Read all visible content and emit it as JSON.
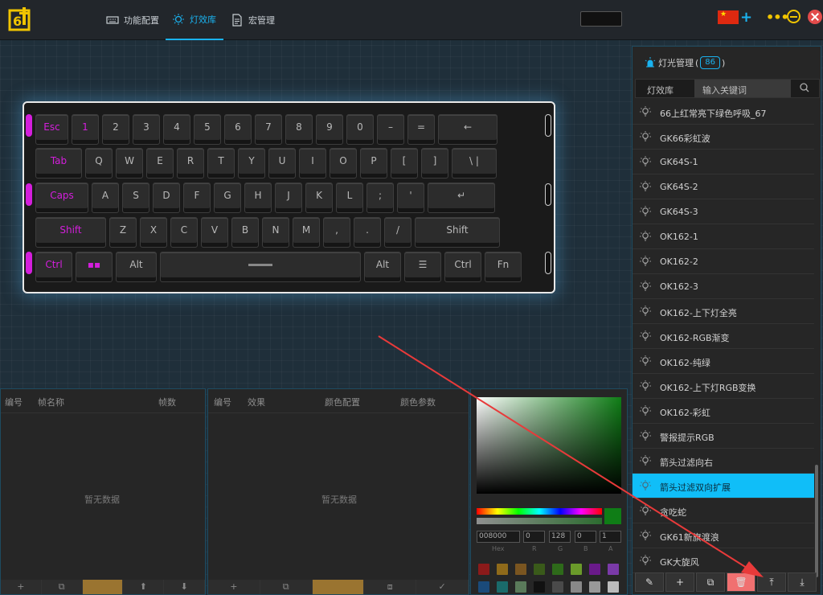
{
  "nav": {
    "tabs": [
      {
        "label": "功能配置",
        "icon": "keyboard-icon"
      },
      {
        "label": "灯效库",
        "icon": "light-icon",
        "active": true
      },
      {
        "label": "宏管理",
        "icon": "document-icon"
      }
    ]
  },
  "window": {
    "more_icon": "•••"
  },
  "keyboard": {
    "accent_color": "#d41edc",
    "rows": [
      [
        "Esc",
        "1",
        "2",
        "3",
        "4",
        "5",
        "6",
        "7",
        "8",
        "9",
        "0",
        "–",
        "=",
        "←"
      ],
      [
        "Tab",
        "Q",
        "W",
        "E",
        "R",
        "T",
        "Y",
        "U",
        "I",
        "O",
        "P",
        "[",
        "]",
        "\\ |"
      ],
      [
        "Caps",
        "A",
        "S",
        "D",
        "F",
        "G",
        "H",
        "J",
        "K",
        "L",
        ";",
        "'",
        "↵"
      ],
      [
        "Shift",
        "Z",
        "X",
        "C",
        "V",
        "B",
        "N",
        "M",
        ",",
        ".",
        "/",
        "Shift"
      ],
      [
        "Ctrl",
        "▪▪",
        "Alt",
        "",
        "Alt",
        "☰",
        "Ctrl",
        "Fn"
      ]
    ],
    "lit_keys": [
      "Esc",
      "1",
      "Tab",
      "Caps",
      "Shift",
      "Ctrl",
      "▪▪"
    ]
  },
  "frames_panel": {
    "headers": [
      "编号",
      "帧名称",
      "帧数"
    ],
    "empty": "暂无数据",
    "toolbar": [
      "+",
      "⧉",
      "",
      "⬆",
      "⬇"
    ]
  },
  "effects_panel": {
    "headers": [
      "编号",
      "效果",
      "颜色配置",
      "颜色参数"
    ],
    "empty": "暂无数据",
    "toolbar": [
      "+",
      "⧉",
      "",
      "⧈",
      "✓"
    ]
  },
  "color_picker": {
    "hex": "008000",
    "r": "0",
    "g": "128",
    "b": "0",
    "a": "1",
    "labels": [
      "Hex",
      "R",
      "G",
      "B",
      "A"
    ],
    "swatches": [
      "#8b1a1a",
      "#8f6a1a",
      "#7a5520",
      "#3a5a1a",
      "#2e6a1a",
      "#6a9a2a",
      "#6a1a8a",
      "#7a3aa8",
      "#1a4a7a",
      "#1a6a6a",
      "#5a7a5a",
      "#111111",
      "#4a4a4a",
      "#888888",
      "#999999",
      "#bbbbbb"
    ]
  },
  "library": {
    "title": "灯光管理",
    "count": "86",
    "tab": "灯效库",
    "search_placeholder": "输入关键词",
    "items": [
      "66上红常亮下绿色呼吸_67",
      "GK66彩虹波",
      "GK64S-1",
      "GK64S-2",
      "GK64S-3",
      "OK162-1",
      "OK162-2",
      "OK162-3",
      "OK162-上下灯全亮",
      "OK162-RGB渐变",
      "OK162-纯绿",
      "OK162-上下灯RGB变换",
      "OK162-彩虹",
      "警报提示RGB",
      "箭头过滤向右",
      "箭头过滤双向扩展",
      "贪吃蛇",
      "GK61新旗渡浪",
      "GK大旋风"
    ],
    "selected_index": 15,
    "toolbar": [
      "✎",
      "+",
      "⧉",
      "🗑",
      "⤒",
      "⤓"
    ]
  }
}
